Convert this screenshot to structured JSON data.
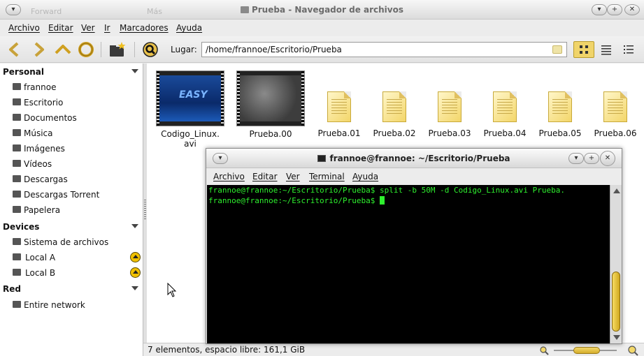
{
  "window": {
    "title": "Prueba - Navegador de archivos",
    "ghost_back": "Forward",
    "ghost_more": "Más"
  },
  "menu": [
    "Archivo",
    "Editar",
    "Ver",
    "Ir",
    "Marcadores",
    "Ayuda"
  ],
  "toolbar": {
    "location_label": "Lugar:",
    "location_value": "/home/frannoe/Escritorio/Prueba",
    "icons": [
      "back-icon",
      "forward-icon",
      "up-icon",
      "reload-icon",
      "new-folder-icon",
      "search-icon"
    ],
    "view_modes": [
      "icons-view-icon",
      "list-view-icon",
      "compact-view-icon"
    ]
  },
  "sidebar": {
    "sections": [
      {
        "title": "Personal",
        "items": [
          {
            "label": "frannoe",
            "icon": "home-icon"
          },
          {
            "label": "Escritorio",
            "icon": "desktop-icon"
          },
          {
            "label": "Documentos",
            "icon": "documents-icon"
          },
          {
            "label": "Música",
            "icon": "music-icon"
          },
          {
            "label": "Imágenes",
            "icon": "pictures-icon"
          },
          {
            "label": "Vídeos",
            "icon": "videos-icon"
          },
          {
            "label": "Descargas",
            "icon": "downloads-icon"
          },
          {
            "label": "Descargas Torrent",
            "icon": "torrent-downloads-icon"
          },
          {
            "label": "Papelera",
            "icon": "trash-icon"
          }
        ]
      },
      {
        "title": "Devices",
        "items": [
          {
            "label": "Sistema de archivos",
            "icon": "filesystem-icon"
          },
          {
            "label": "Local A",
            "icon": "drive-icon",
            "eject": true
          },
          {
            "label": "Local B",
            "icon": "drive-icon",
            "eject": true
          }
        ]
      },
      {
        "title": "Red",
        "items": [
          {
            "label": "Entire network",
            "icon": "network-icon"
          }
        ]
      }
    ]
  },
  "files": [
    {
      "name": "Codigo_Linux.\navi",
      "type": "video",
      "thumb": "blue",
      "thumb_text": "EASY"
    },
    {
      "name": "Prueba.00",
      "type": "video",
      "thumb": "grey"
    },
    {
      "name": "Prueba.01",
      "type": "document"
    },
    {
      "name": "Prueba.02",
      "type": "document"
    },
    {
      "name": "Prueba.03",
      "type": "document"
    },
    {
      "name": "Prueba.04",
      "type": "document"
    },
    {
      "name": "Prueba.05",
      "type": "document"
    },
    {
      "name": "Prueba.06",
      "type": "document"
    }
  ],
  "status": {
    "text": "7 elementos, espacio libre: 161,1 GiB"
  },
  "terminal": {
    "title": "frannoe@frannoe: ~/Escritorio/Prueba",
    "menu": [
      "Archivo",
      "Editar",
      "Ver",
      "Terminal",
      "Ayuda"
    ],
    "lines": [
      "frannoe@frannoe:~/Escritorio/Prueba$ split -b 50M -d Codigo_Linux.avi Prueba.",
      "frannoe@frannoe:~/Escritorio/Prueba$ "
    ],
    "text_color": "#2ef02e",
    "background": "#000000"
  }
}
